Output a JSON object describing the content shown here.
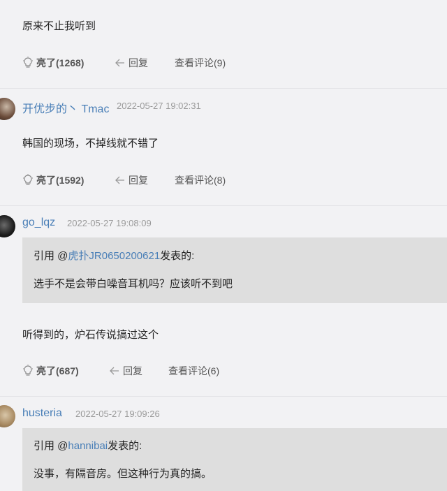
{
  "posts": [
    {
      "content": "原来不止我听到",
      "actions": {
        "light": "亮了(1268)",
        "reply": "回复",
        "view_comments": "查看评论(9)"
      }
    },
    {
      "username": "开优步的丶 Tmac",
      "timestamp": "2022-05-27 19:02:31",
      "content": "韩国的现场，不掉线就不错了",
      "actions": {
        "light": "亮了(1592)",
        "reply": "回复",
        "view_comments": "查看评论(8)"
      }
    },
    {
      "username": "go_lqz",
      "timestamp": "2022-05-27 19:08:09",
      "quote": {
        "prefix": "引用 @",
        "author": "虎扑JR0650200621",
        "suffix": "发表的:",
        "text": "选手不是会带白噪音耳机吗？应该听不到吧"
      },
      "content": "听得到的，炉石传说搞过这个",
      "actions": {
        "light": "亮了(687)",
        "reply": "回复",
        "view_comments": "查看评论(6)"
      }
    },
    {
      "username": "husteria",
      "timestamp": "2022-05-27 19:09:26",
      "quote": {
        "prefix": "引用 @",
        "author": "hannibai",
        "suffix": "发表的:",
        "text": "没事，有隔音房。但这种行为真的搞。"
      }
    }
  ]
}
